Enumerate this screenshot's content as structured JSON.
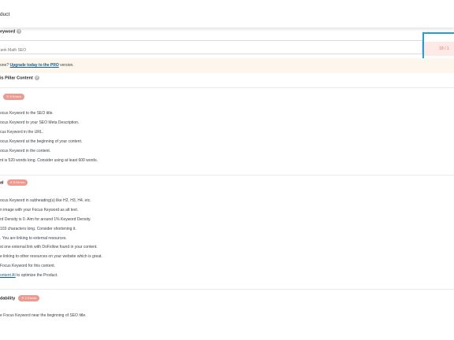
{
  "header": {
    "title": "duct"
  },
  "focus_keyword": {
    "label": "eyword",
    "help_icon": "question-circle-icon",
    "placeholder": "Rank Math SEO",
    "score_label": "19 / 1"
  },
  "promo": {
    "prefix": "one?",
    "link_text": "Upgrade today to the PRO",
    "suffix": "version."
  },
  "pillar": {
    "label": "is Pillar Content"
  },
  "sections": [
    {
      "title": "",
      "badge": "✕ 6 Errors",
      "items": [
        "ocus Keyword to the SEO title.",
        "ocus Keyword to your SEO Meta Description.",
        "cus Keyword in the URL.",
        "ocus Keyword at the beginning of your content.",
        "ocus Keyword in the content.",
        "nt is 520 words long. Consider using at least 600 words."
      ]
    },
    {
      "title": "al",
      "badge": "✕ 5 Errors",
      "items": [
        "ocus Keyword in subheading(s) like H2, H3, H4, etc.",
        "n image with your Focus Keyword as alt text.",
        "rd Density is 0. Aim for around 1% Keyword Density.",
        "103 characters long. Consider shortening it.",
        ". You are linking to external resources.",
        "st one external link with DoFollow found in your content.",
        "e linking to other resources on your website which is great.",
        "Focus Keyword for this content."
      ],
      "content_ai": {
        "link": "ontent AI",
        "suffix": "to optimize the Product."
      }
    },
    {
      "title": "dability",
      "badge": "✕ 1 Errors",
      "items": [
        "e Focus Keyword near the beginning of SEO title."
      ]
    }
  ],
  "colors": {
    "error_badge": "#ed9b91",
    "score_text": "#ed6d60",
    "focus_outline": "#1ea1d8",
    "link": "#135e96"
  }
}
